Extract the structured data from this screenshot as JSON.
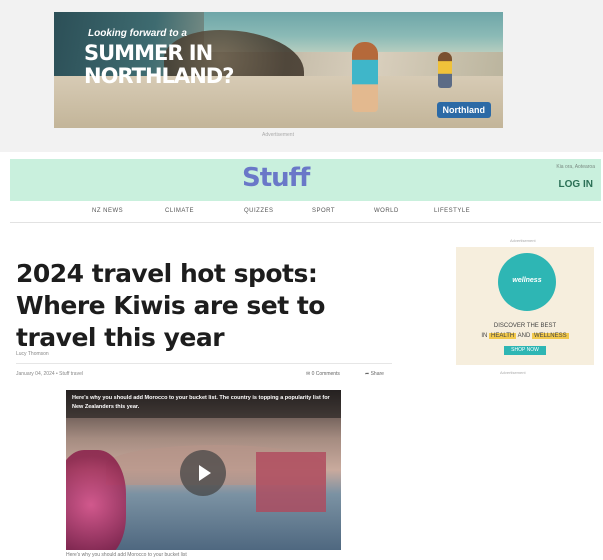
{
  "ad_top": {
    "eyebrow": "Looking forward to a",
    "headline_lines": [
      "SUMMER IN",
      "NORTHLAND?"
    ],
    "logo": "Northland",
    "label": "Advertisement"
  },
  "masthead": {
    "brand": "Stuff",
    "greeting": "Kia ora, Aotearoa",
    "login": "LOG IN"
  },
  "nav": {
    "items": [
      "NZ NEWS",
      "CLIMATE",
      "QUIZZES",
      "SPORT",
      "WORLD",
      "LIFESTYLE"
    ]
  },
  "article": {
    "headline": "2024 travel hot spots: Where Kiwis are set to travel this year",
    "author": "Lucy Thomson",
    "date": "January 04, 2024 • Stuff travel",
    "comments": "0 Comments",
    "share": "Share"
  },
  "video": {
    "caption": "Here's why you should add Morocco to your bucket list. The country is topping a popularity list for New Zealanders this year.",
    "below_caption": "Here's why you should add Morocco to your bucket list"
  },
  "side_ad": {
    "label": "Advertisement",
    "brand": "wellness",
    "line1": "DISCOVER THE BEST",
    "line2_left": "IN",
    "highlight1": "HEALTH",
    "line2_mid": "AND",
    "highlight2": "WELLNESS",
    "button": "SHOP NOW",
    "foot": "Advertisement"
  }
}
